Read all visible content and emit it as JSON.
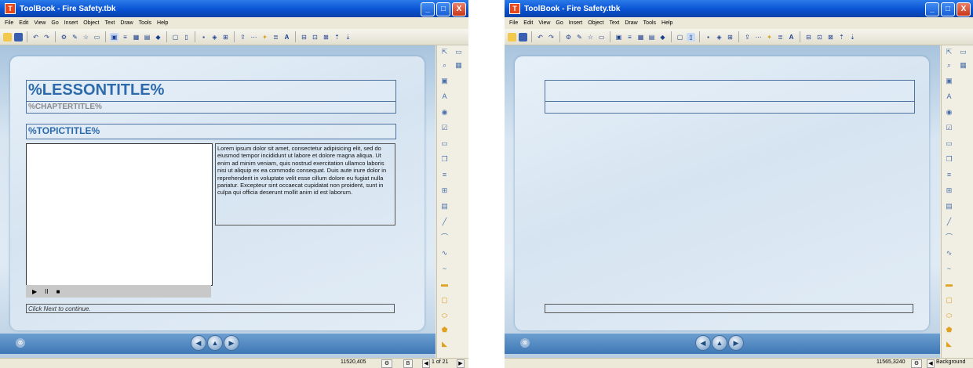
{
  "window1": {
    "title": "ToolBook - Fire Safety.tbk",
    "app_icon_glyph": "T",
    "window_buttons": {
      "minimize": "_",
      "maximize": "□",
      "close": "X"
    },
    "menu": [
      "File",
      "Edit",
      "View",
      "Go",
      "Insert",
      "Object",
      "Text",
      "Draw",
      "Tools",
      "Help"
    ],
    "page": {
      "lesson_title": "%LESSONTITLE%",
      "chapter_title": "%CHAPTERTITLE%",
      "topic_title": "%TOPICTITLE%",
      "body_text": "Lorem ipsum dolor sit amet, consectetur adipisicing elit, sed do eiusmod tempor incididunt ut labore et dolore magna aliqua. Ut enim ad minim veniam, quis nostrud exercitation ullamco laboris nisi ut aliquip ex ea commodo consequat. Duis aute irure dolor in reprehenderit in voluptate velit esse cillum dolore eu fugiat nulla pariatur. Excepteur sint occaecat cupidatat non proident, sunt in culpa qui officia deserunt mollit anim id est laborum.",
      "click_next": "Click Next to continue.",
      "media_controls": {
        "play": "▶",
        "pause": "II",
        "stop": "■"
      }
    },
    "status": {
      "coords": "11520,405",
      "page_indicator": "1 of 21"
    }
  },
  "window2": {
    "title": "ToolBook - Fire Safety.tbk",
    "app_icon_glyph": "T",
    "window_buttons": {
      "minimize": "_",
      "maximize": "□",
      "close": "X"
    },
    "menu": [
      "File",
      "Edit",
      "View",
      "Go",
      "Insert",
      "Object",
      "Text",
      "Draw",
      "Tools",
      "Help"
    ],
    "status": {
      "coords": "11565,3240",
      "page_indicator": "Background"
    }
  },
  "nav": {
    "prev": "◀",
    "home": "▲",
    "next": "▶",
    "exit": "⊗"
  },
  "status_icons": {
    "nav": "◀",
    "next": "▶",
    "mode": "B",
    "gear": "⚙"
  },
  "colors": {
    "titlebar": "#0a53d4",
    "title_text": "#2d6aab",
    "chapter_text": "#8a8a8a",
    "navbar": "#3e78b6"
  }
}
